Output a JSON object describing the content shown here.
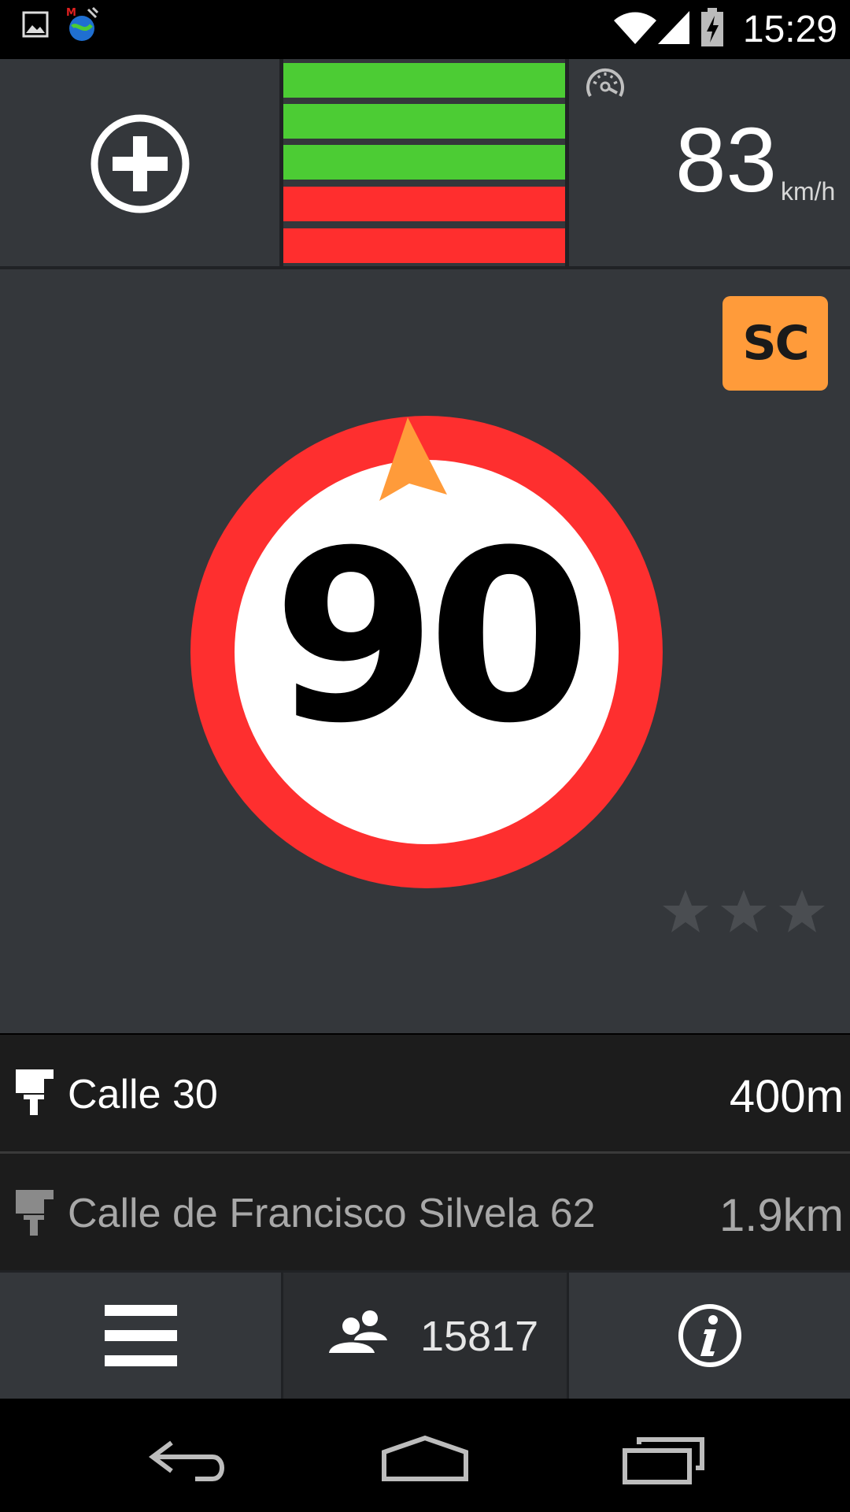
{
  "status_bar": {
    "time": "15:29",
    "icons": [
      "image-icon",
      "gps-app-icon",
      "wifi-icon",
      "signal-icon",
      "battery-charging-icon"
    ]
  },
  "top_panel": {
    "add_icon": "add-circle-icon",
    "signal_bars": [
      {
        "color": "#4ccc34"
      },
      {
        "color": "#4ccc34"
      },
      {
        "color": "#4ccc34"
      },
      {
        "color": "#ff2e2e"
      },
      {
        "color": "#ff2e2e"
      }
    ],
    "speedometer_icon": "speedometer-icon",
    "speed": "83",
    "speed_unit": "km/h"
  },
  "main": {
    "badge": "SC",
    "speed_limit": "90",
    "sign_ring_color": "#fe2f2f",
    "heading_color": "#ff9b3a",
    "rating": {
      "filled": 0,
      "total": 3
    }
  },
  "routes": [
    {
      "name": "Calle 30",
      "distance": "400m"
    },
    {
      "name": "Calle de Francisco Silvela 62",
      "distance": "1.9km"
    }
  ],
  "toolbar": {
    "users_count": "15817"
  },
  "colors": {
    "panel": "#34373b",
    "row": "#1c1c1c",
    "accent": "#ff9b3a"
  }
}
